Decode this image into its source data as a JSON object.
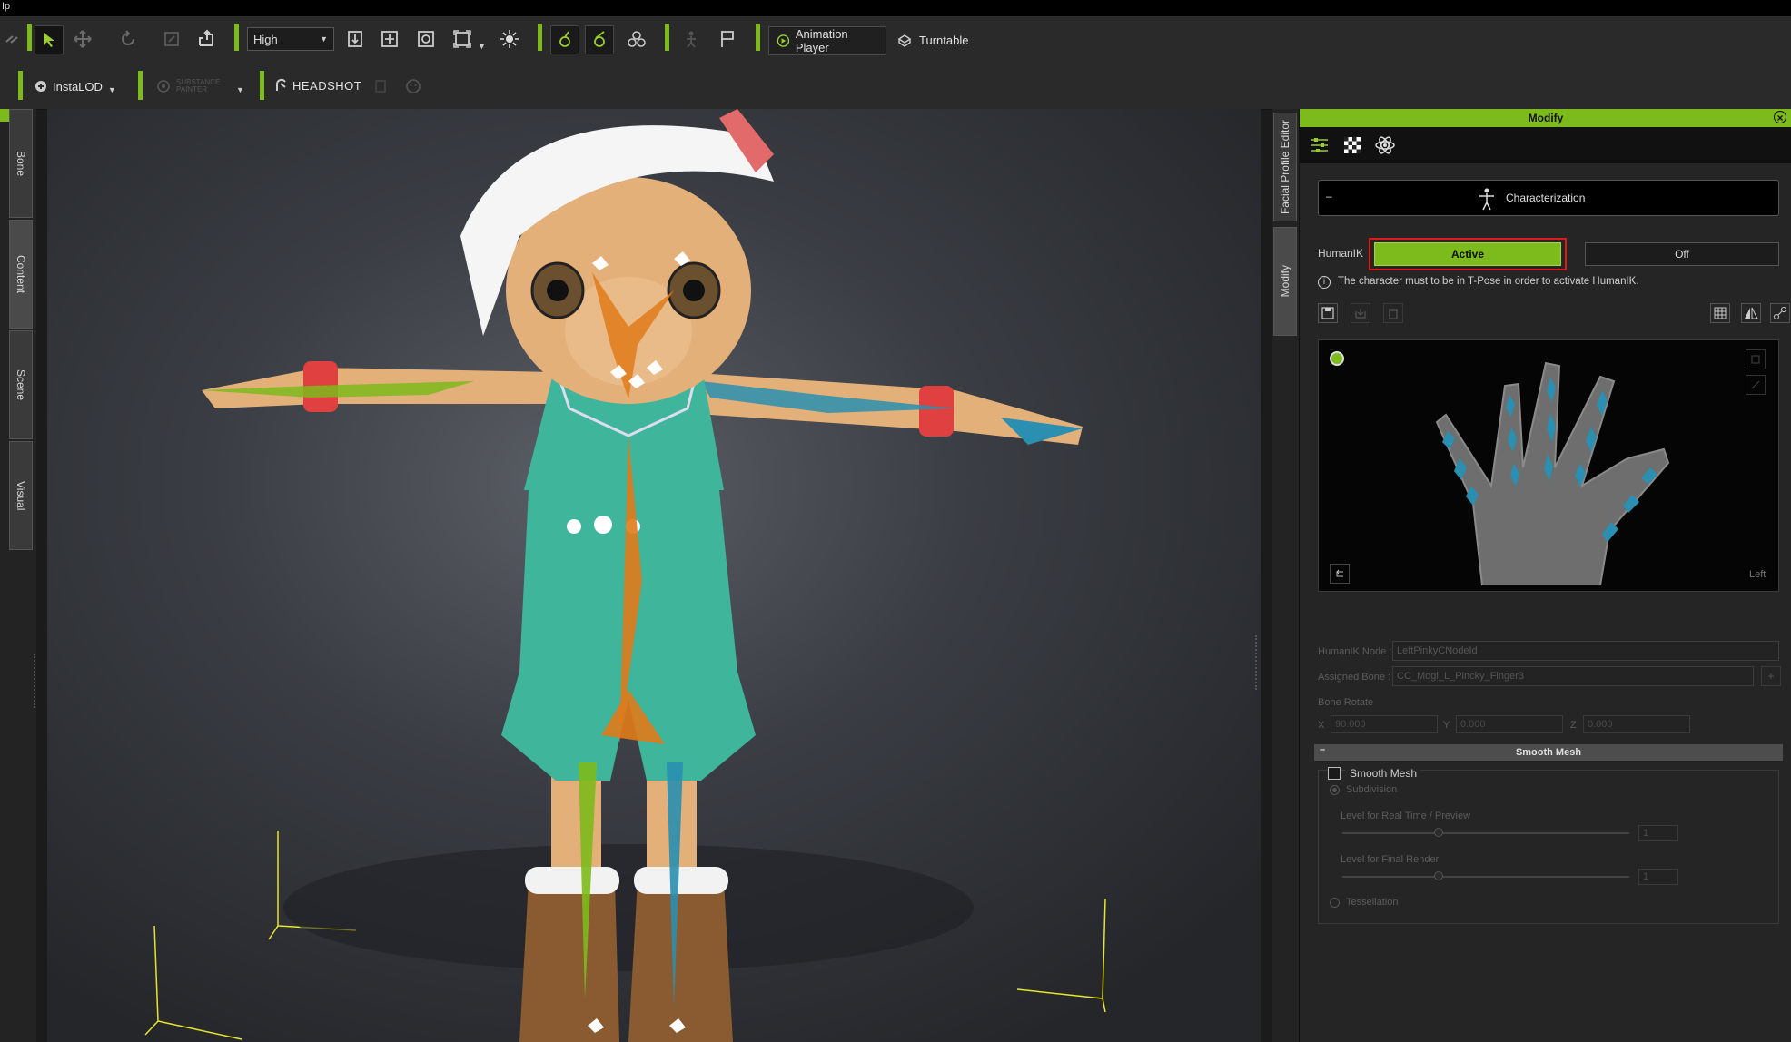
{
  "app": {
    "title_fragment": "Ip"
  },
  "toolbar1": {
    "quality_select": "High",
    "animation_player_label": "Animation Player",
    "turntable_label": "Turntable"
  },
  "toolbar2": {
    "instalod_label": "InstaLOD",
    "substance_label": "SUBSTANCE PAINTER",
    "headshot_label": "HEADSHOT"
  },
  "left_tabs": [
    "Bone",
    "Content",
    "Scene",
    "Visual"
  ],
  "right_tabs": [
    "Facial Profile Editor",
    "Modify"
  ],
  "panel": {
    "title": "Modify",
    "characterization_label": "Characterization",
    "humanik_label": "HumanIK",
    "active_label": "Active",
    "off_label": "Off",
    "info_text": "The character must to be in T-Pose in order to activate HumanIK.",
    "hand_side_label": "Left",
    "humanik_node_label": "HumanIK Node :",
    "humanik_node_value": "LeftPinkyCNodeId",
    "assigned_bone_label": "Assigned Bone :",
    "assigned_bone_value": "CC_Mogl_L_Pincky_Finger3",
    "bone_rotate_label": "Bone Rotate",
    "x_label": "X",
    "x_value": "90.000",
    "y_label": "Y",
    "y_value": "0.000",
    "z_label": "Z",
    "z_value": "0.000",
    "smooth_mesh_header": "Smooth Mesh",
    "smooth_mesh_checkbox": "Smooth Mesh",
    "subdivision_label": "Subdivision",
    "level_realtime_label": "Level for Real Time / Preview",
    "level_realtime_value": "1",
    "level_final_label": "Level for Final Render",
    "level_final_value": "1",
    "tessellation_label": "Tessellation"
  },
  "colors": {
    "accent_green": "#7dba1b",
    "highlight_red": "#e01a1a",
    "bone_orange": "#e07a1a",
    "bone_green": "#7dba1b",
    "bone_blue": "#2a8fb0"
  }
}
